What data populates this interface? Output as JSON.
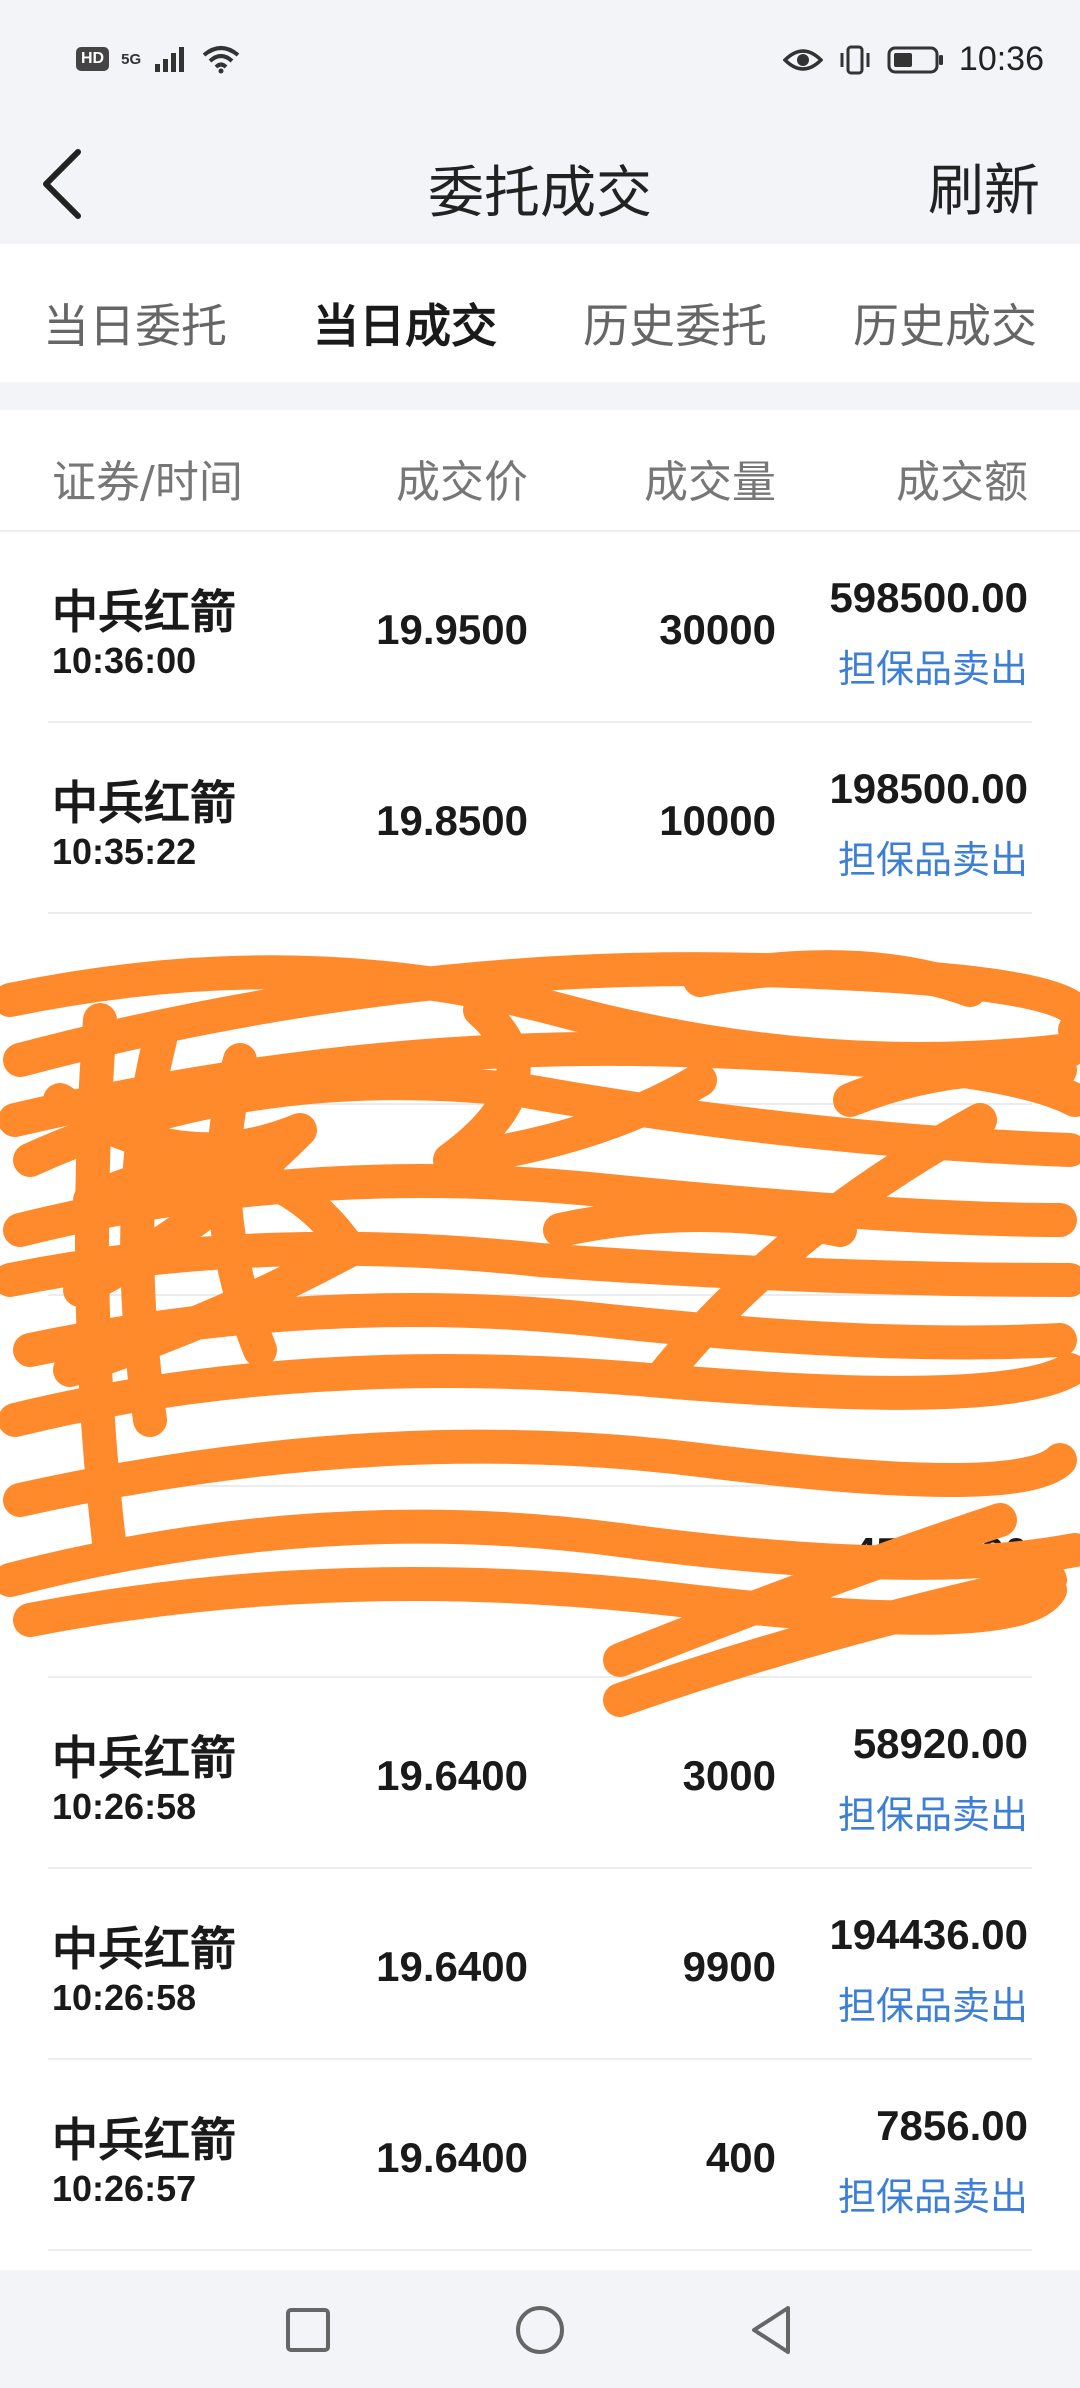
{
  "status_bar": {
    "hd": "HD",
    "net": "5G",
    "time": "10:36",
    "icons": [
      "signal-icon",
      "wifi-icon",
      "eye-icon",
      "vibrate-icon",
      "battery-icon"
    ]
  },
  "header": {
    "title": "委托成交",
    "refresh_label": "刷新"
  },
  "tabs": [
    {
      "label": "当日委托",
      "active": false
    },
    {
      "label": "当日成交",
      "active": true
    },
    {
      "label": "历史委托",
      "active": false
    },
    {
      "label": "历史成交",
      "active": false
    }
  ],
  "table": {
    "columns": [
      "证券/时间",
      "成交价",
      "成交量",
      "成交额"
    ],
    "rows": [
      {
        "name": "中兵红箭",
        "time": "10:36:00",
        "price": "19.9500",
        "qty": "30000",
        "amount": "598500.00",
        "type": "担保品卖出"
      },
      {
        "name": "中兵红箭",
        "time": "10:35:22",
        "price": "19.8500",
        "qty": "10000",
        "amount": "198500.00",
        "type": "担保品卖出"
      },
      {
        "name": "",
        "time": "",
        "price": "",
        "qty": "",
        "amount": "",
        "type": ""
      },
      {
        "name": "",
        "time": "",
        "price": "",
        "qty": "",
        "amount": "",
        "type": ""
      },
      {
        "name": "",
        "time": "",
        "price": "",
        "qty": "",
        "amount": "",
        "type": ""
      },
      {
        "name": "",
        "time": "",
        "price": "",
        "qty": "",
        "amount": "45624.00",
        "type": ""
      },
      {
        "name": "中兵红箭",
        "time": "10:26:58",
        "price": "19.6400",
        "qty": "3000",
        "amount": "58920.00",
        "type": "担保品卖出"
      },
      {
        "name": "中兵红箭",
        "time": "10:26:58",
        "price": "19.6400",
        "qty": "9900",
        "amount": "194436.00",
        "type": "担保品卖出"
      },
      {
        "name": "中兵红箭",
        "time": "10:26:57",
        "price": "19.6400",
        "qty": "400",
        "amount": "7856.00",
        "type": "担保品卖出"
      }
    ]
  },
  "colors": {
    "accent_red": "#d73a3a",
    "sell_blue": "#3d7fd6",
    "scribble_orange": "#ff8a2b"
  },
  "navbar": {
    "icons": [
      "recent-apps-icon",
      "home-icon",
      "back-nav-icon"
    ]
  }
}
